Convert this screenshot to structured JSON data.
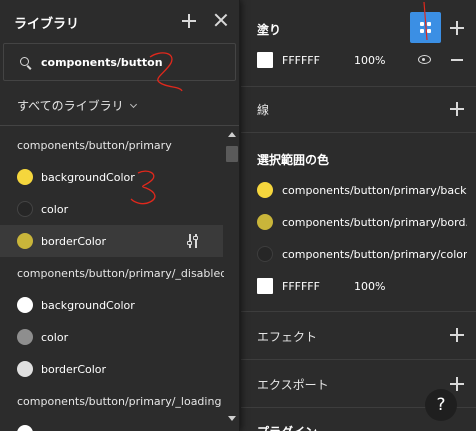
{
  "library_panel": {
    "title": "ライブラリ",
    "add_icon": "plus-icon",
    "close_icon": "close-icon",
    "search": {
      "icon": "search-icon",
      "value": "components/button"
    },
    "filter_label": "すべてのライブラリ",
    "groups": [
      {
        "name": "components/button/primary",
        "items": [
          {
            "label": "backgroundColor",
            "color": "#f5d63d"
          },
          {
            "label": "color",
            "color": "#262626"
          },
          {
            "label": "borderColor",
            "color": "#c9b53a",
            "selected": true
          }
        ]
      },
      {
        "name": "components/button/primary/_disabled",
        "items": [
          {
            "label": "backgroundColor",
            "color": "#ffffff"
          },
          {
            "label": "color",
            "color": "#8e8e8e"
          },
          {
            "label": "borderColor",
            "color": "#e0e0e0"
          }
        ]
      },
      {
        "name": "components/button/primary/_loading",
        "items": []
      }
    ]
  },
  "properties_panel": {
    "fill": {
      "heading": "塗り",
      "color": "#ffffff",
      "hex": "FFFFFF",
      "opacity": "100%"
    },
    "stroke": {
      "heading": "線"
    },
    "selection_colors": {
      "heading": "選択範囲の色",
      "items": [
        {
          "label": "components/button/primary/back...",
          "color": "#f5d63d"
        },
        {
          "label": "components/button/primary/bord...",
          "color": "#c9b53a"
        },
        {
          "label": "components/button/primary/color",
          "color": "#262626"
        }
      ],
      "hex_row": {
        "hex": "FFFFFF",
        "opacity": "100%"
      }
    },
    "effects": {
      "heading": "エフェクト"
    },
    "export": {
      "heading": "エクスポート"
    },
    "plugin": {
      "heading": "プラグイン"
    },
    "help_label": "?"
  },
  "colors": {
    "accent_blue": "#3b8fe4",
    "panel_bg": "#2c2c2c",
    "annotation_red": "#e0281c"
  }
}
